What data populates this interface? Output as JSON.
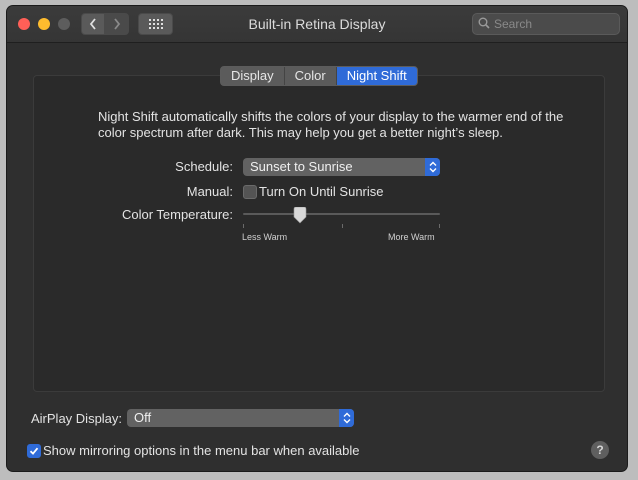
{
  "window": {
    "title": "Built-in Retina Display"
  },
  "search": {
    "placeholder": "Search"
  },
  "tabs": [
    {
      "label": "Display"
    },
    {
      "label": "Color"
    },
    {
      "label": "Night Shift",
      "active": true
    }
  ],
  "night_shift": {
    "description": "Night Shift automatically shifts the colors of your display to the warmer end of the color spectrum after dark. This may help you get a better night’s sleep.",
    "schedule_label": "Schedule:",
    "schedule_value": "Sunset to Sunrise",
    "manual_label": "Manual:",
    "manual_checkbox_label": "Turn On Until Sunrise",
    "manual_checked": false,
    "color_temp_label": "Color Temperature:",
    "color_temp_level": 0.29,
    "less_warm_label": "Less Warm",
    "more_warm_label": "More Warm"
  },
  "footer": {
    "airplay_label": "AirPlay Display:",
    "airplay_value": "Off",
    "mirroring_label": "Show mirroring options in the menu bar when available",
    "mirroring_checked": true,
    "help_glyph": "?"
  },
  "colors": {
    "accent": "#2f6bd8",
    "window_bg": "#2f2f2f",
    "traffic_red": "#ff5f57",
    "traffic_yellow": "#febc2e"
  },
  "icons": {
    "back": "chevron-left-icon",
    "forward": "chevron-right-icon",
    "grid": "grid-icon",
    "search": "search-icon",
    "popup_arrows": "up-down-arrows-icon",
    "check": "checkmark-icon",
    "help": "help-icon"
  }
}
